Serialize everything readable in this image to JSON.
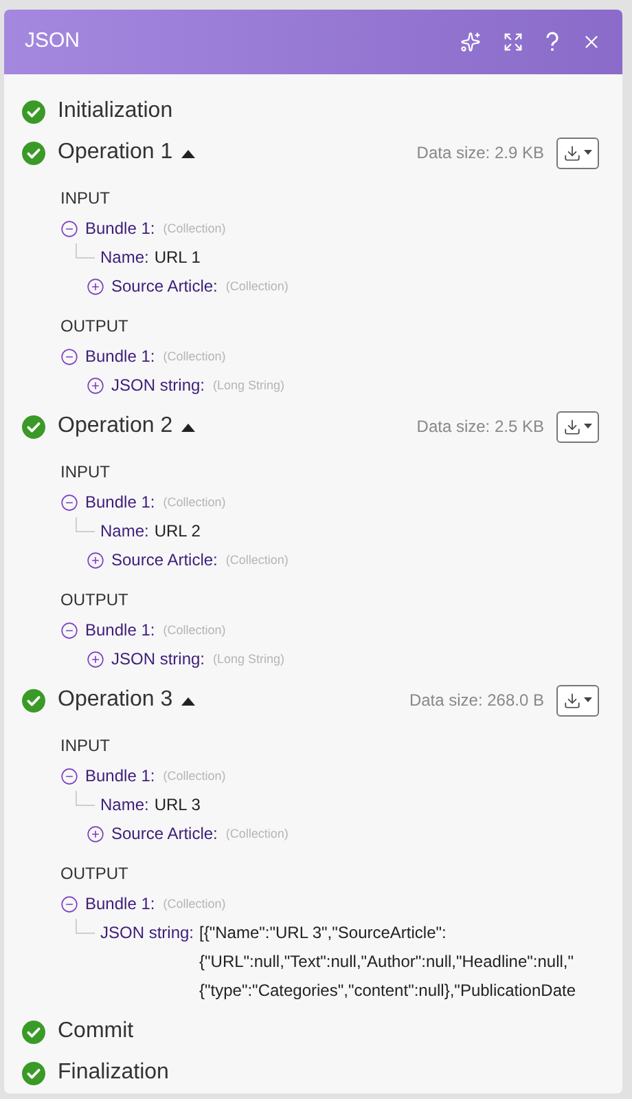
{
  "window": {
    "title": "JSON"
  },
  "sections": [
    {
      "kind": "simple",
      "name": "Initialization",
      "ok": true
    },
    {
      "kind": "operation",
      "name": "Operation 1",
      "ok": true,
      "expanded": true,
      "data_size": "Data size: 2.9 KB",
      "groups": [
        {
          "label": "INPUT",
          "nodes": [
            {
              "label": "Bundle 1:",
              "type": "(Collection)",
              "expanded": true,
              "children": [
                {
                  "label": "Name:",
                  "value": "URL 1"
                },
                {
                  "label": "Source Article:",
                  "type": "(Collection)",
                  "expanded": false
                }
              ]
            }
          ]
        },
        {
          "label": "OUTPUT",
          "nodes": [
            {
              "label": "Bundle 1:",
              "type": "(Collection)",
              "expanded": true,
              "children": [
                {
                  "label": "JSON string:",
                  "type": "(Long String)",
                  "expanded": false
                }
              ]
            }
          ]
        }
      ]
    },
    {
      "kind": "operation",
      "name": "Operation 2",
      "ok": true,
      "expanded": true,
      "data_size": "Data size: 2.5 KB",
      "groups": [
        {
          "label": "INPUT",
          "nodes": [
            {
              "label": "Bundle 1:",
              "type": "(Collection)",
              "expanded": true,
              "children": [
                {
                  "label": "Name:",
                  "value": "URL 2"
                },
                {
                  "label": "Source Article:",
                  "type": "(Collection)",
                  "expanded": false
                }
              ]
            }
          ]
        },
        {
          "label": "OUTPUT",
          "nodes": [
            {
              "label": "Bundle 1:",
              "type": "(Collection)",
              "expanded": true,
              "children": [
                {
                  "label": "JSON string:",
                  "type": "(Long String)",
                  "expanded": false
                }
              ]
            }
          ]
        }
      ]
    },
    {
      "kind": "operation",
      "name": "Operation 3",
      "ok": true,
      "expanded": true,
      "data_size": "Data size: 268.0 B",
      "groups": [
        {
          "label": "INPUT",
          "nodes": [
            {
              "label": "Bundle 1:",
              "type": "(Collection)",
              "expanded": true,
              "children": [
                {
                  "label": "Name:",
                  "value": "URL 3"
                },
                {
                  "label": "Source Article:",
                  "type": "(Collection)",
                  "expanded": false
                }
              ]
            }
          ]
        },
        {
          "label": "OUTPUT",
          "nodes": [
            {
              "label": "Bundle 1:",
              "type": "(Collection)",
              "expanded": true,
              "children": [
                {
                  "label": "JSON string:",
                  "value_lines": [
                    "[{\"Name\":\"URL 3\",\"SourceArticle\":",
                    "{\"URL\":null,\"Text\":null,\"Author\":null,\"Headline\":null,\"",
                    "{\"type\":\"Categories\",\"content\":null},\"PublicationDate"
                  ]
                }
              ]
            }
          ]
        }
      ]
    },
    {
      "kind": "simple",
      "name": "Commit",
      "ok": true
    },
    {
      "kind": "simple",
      "name": "Finalization",
      "ok": true
    }
  ]
}
